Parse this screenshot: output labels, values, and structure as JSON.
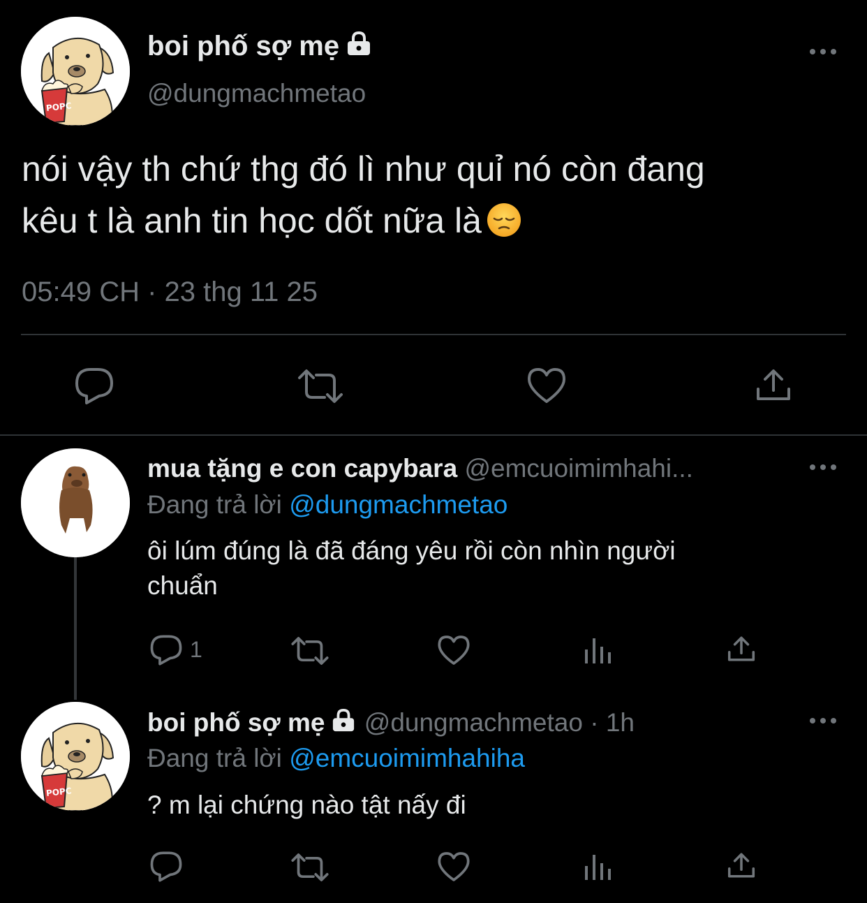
{
  "main_tweet": {
    "display_name": "boi phố sợ mẹ",
    "handle": "@dungmachmetao",
    "text_line1": "nói vậy th chứ thg đó lì như quỉ nó còn đang",
    "text_line2": "kêu t là anh tin học dốt nữa là",
    "emoji": "😔",
    "timestamp": "05:49 CH · 23 thg 11 25",
    "icons": [
      "reply-icon",
      "retweet-icon",
      "like-icon",
      "share-icon"
    ]
  },
  "replies": [
    {
      "display_name": "mua tặng e con capybara",
      "handle": "@emcuoimimhahi...",
      "time": "",
      "replying_label": "Đang trả lời",
      "replying_to": "@dungmachmetao",
      "text_line1": "ôi lúm đúng là đã đáng yêu rồi còn nhìn người",
      "text_line2": "chuẩn",
      "reply_count": "1"
    },
    {
      "display_name": "boi phố sợ mẹ",
      "handle": "@dungmachmetao",
      "time": "· 1h",
      "replying_label": "Đang trả lời",
      "replying_to": "@emcuoimimhahiha",
      "text_line1": "? m lại chứng nào tật nấy đi",
      "text_line2": "",
      "reply_count": ""
    }
  ],
  "colors": {
    "background": "#000000",
    "text": "#e7e9ea",
    "muted": "#71767b",
    "accent": "#1d9bf0",
    "divider": "#2f3336"
  }
}
